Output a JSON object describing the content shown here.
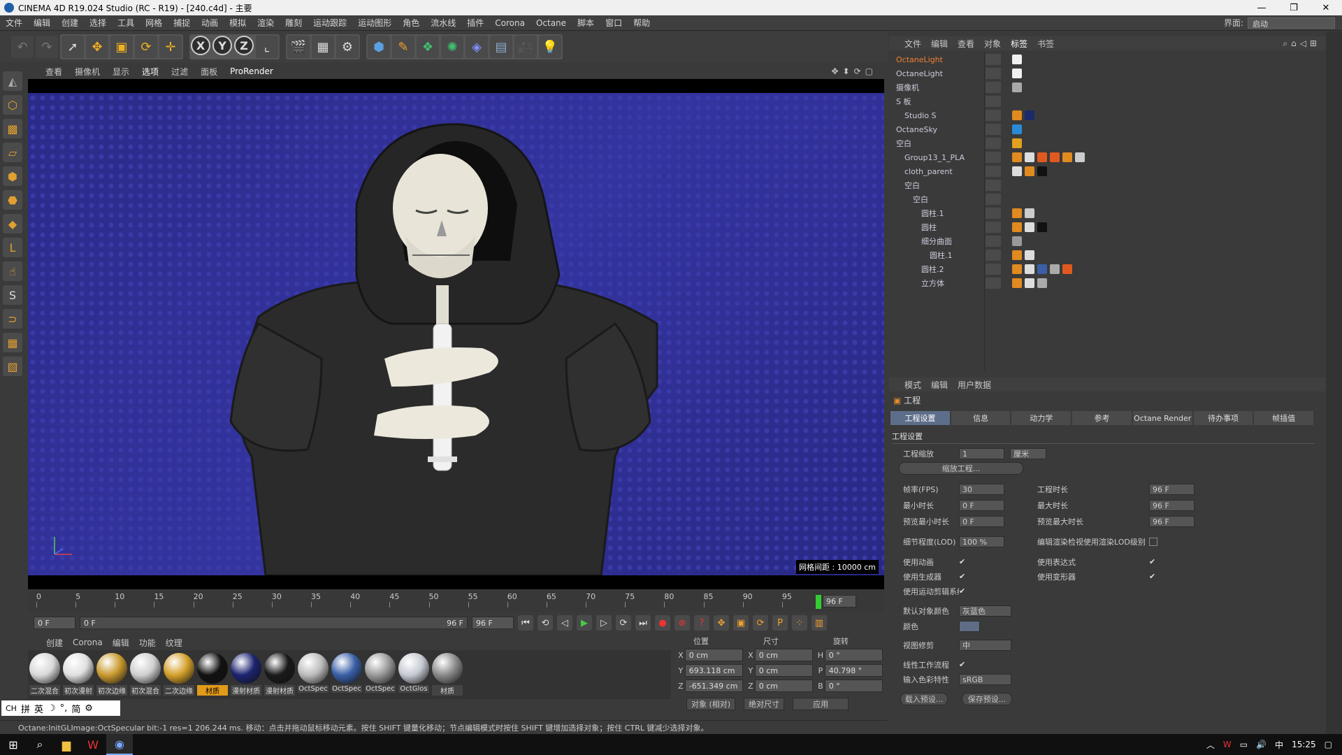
{
  "window": {
    "title": "CINEMA 4D R19.024 Studio (RC - R19) - [240.c4d] - 主要",
    "min": "—",
    "max": "❐",
    "close": "✕"
  },
  "menu": {
    "items": [
      "文件",
      "编辑",
      "创建",
      "选择",
      "工具",
      "网格",
      "捕捉",
      "动画",
      "模拟",
      "渲染",
      "雕刻",
      "运动跟踪",
      "运动图形",
      "角色",
      "流水线",
      "插件",
      "Corona",
      "Octane",
      "脚本",
      "窗口",
      "帮助"
    ],
    "layout_label": "界面:",
    "layout_value": "启动"
  },
  "viewport": {
    "menu": [
      "查看",
      "摄像机",
      "显示",
      "选项",
      "过滤",
      "面板"
    ],
    "prorender": "ProRender",
    "grid_info": "网格间距 : 10000 cm"
  },
  "timeline": {
    "ticks": [
      "0",
      "5",
      "10",
      "15",
      "20",
      "25",
      "30",
      "35",
      "40",
      "45",
      "50",
      "55",
      "60",
      "65",
      "70",
      "75",
      "80",
      "85",
      "90",
      "95"
    ],
    "current_frame": "96 F",
    "start": "0 F",
    "range_start": "0 F",
    "range_end": "96 F",
    "end": "96 F"
  },
  "material_manager": {
    "menu": [
      "创建",
      "Corona",
      "编辑",
      "功能",
      "纹理"
    ],
    "materials": [
      {
        "label": "二次混合",
        "color": "#d8d8d8"
      },
      {
        "label": "初次漫射",
        "color": "#e0e0e0"
      },
      {
        "label": "初次边缘",
        "color": "#c99a2e"
      },
      {
        "label": "初次混合",
        "color": "#cfcfcf"
      },
      {
        "label": "二次边缘",
        "color": "#d4a02a"
      },
      {
        "label": "材质",
        "color": "#111111",
        "selected": true
      },
      {
        "label": "漫射材质",
        "color": "#1c2470"
      },
      {
        "label": "漫射材质",
        "color": "#1a1a1a"
      },
      {
        "label": "OctSpec",
        "color": "#bcbcbc"
      },
      {
        "label": "OctSpec",
        "color": "#3a5fa8"
      },
      {
        "label": "OctSpec",
        "color": "#9a9a9a"
      },
      {
        "label": "OctGlos",
        "color": "#c5cad2"
      },
      {
        "label": "材质",
        "color": "#8a8a8a"
      }
    ]
  },
  "coordinates": {
    "headers": [
      "位置",
      "尺寸",
      "旋转"
    ],
    "rows": [
      {
        "pos_label": "X",
        "pos": "0 cm",
        "size_label": "X",
        "size": "0 cm",
        "rot_label": "H",
        "rot": "0 °"
      },
      {
        "pos_label": "Y",
        "pos": "693.118 cm",
        "size_label": "Y",
        "size": "0 cm",
        "rot_label": "P",
        "rot": "40.798 °"
      },
      {
        "pos_label": "Z",
        "pos": "-651.349 cm",
        "size_label": "Z",
        "size": "0 cm",
        "rot_label": "B",
        "rot": "0 °"
      }
    ],
    "mode": "对象 (相对)",
    "size_mode": "绝对尺寸",
    "apply": "应用"
  },
  "ime": {
    "items": [
      "CH",
      "拼",
      "英",
      "☽",
      "°,",
      "简",
      "⚙"
    ]
  },
  "status": "Octane:InitGLImage:OctSpecular  bit:-1 res=1 206.244 ms.     移动：点击并拖动鼠标移动元素。按住 SHIFT 键量化移动；节点编辑模式时按住 SHIFT 键增加选择对象；按住 CTRL 键减少选择对象。",
  "object_manager": {
    "menu": [
      "文件",
      "编辑",
      "查看",
      "对象",
      "标签",
      "书签"
    ],
    "active_menu": "标签",
    "objects": [
      {
        "name": "OctaneLight",
        "indent": 0,
        "hot": true,
        "tags": [
          "#f0f0f0"
        ]
      },
      {
        "name": "OctaneLight",
        "indent": 0,
        "hot": false,
        "tags": [
          "#f0f0f0"
        ]
      },
      {
        "name": "摄像机",
        "indent": 0,
        "hot": false,
        "tags": [
          "#aaaaaa"
        ]
      },
      {
        "name": "S 板",
        "indent": 0,
        "hot": false,
        "tags": []
      },
      {
        "name": "Studio S",
        "indent": 1,
        "hot": false,
        "tags": [
          "#e08a20",
          "#1a2a6a"
        ]
      },
      {
        "name": "OctaneSky",
        "indent": 0,
        "hot": false,
        "tags": [
          "#2a8ad8"
        ]
      },
      {
        "name": "空白",
        "indent": 0,
        "hot": false,
        "tags": [
          "#e0a020"
        ]
      },
      {
        "name": "Group13_1_PLA",
        "indent": 1,
        "hot": false,
        "tags": [
          "#e08a20",
          "#dddddd",
          "#e05a20",
          "#e05a20",
          "#e08a20",
          "#cccccc"
        ]
      },
      {
        "name": "cloth_parent",
        "indent": 1,
        "hot": false,
        "tags": [
          "#dddddd",
          "#e08a20",
          "#111111"
        ]
      },
      {
        "name": "空白",
        "indent": 1,
        "hot": false,
        "tags": []
      },
      {
        "name": "空白",
        "indent": 2,
        "hot": false,
        "tags": []
      },
      {
        "name": "圆柱.1",
        "indent": 3,
        "hot": false,
        "tags": [
          "#e08a20",
          "#cccccc"
        ]
      },
      {
        "name": "圆柱",
        "indent": 3,
        "hot": false,
        "tags": [
          "#e08a20",
          "#dddddd",
          "#111111"
        ]
      },
      {
        "name": "细分曲面",
        "indent": 3,
        "hot": false,
        "tags": [
          "#999999"
        ]
      },
      {
        "name": "圆柱.1",
        "indent": 4,
        "hot": false,
        "tags": [
          "#e08a20",
          "#dddddd"
        ]
      },
      {
        "name": "圆柱.2",
        "indent": 3,
        "hot": false,
        "tags": [
          "#e08a20",
          "#dddddd",
          "#3a5fa8",
          "#aaaaaa",
          "#e05a20"
        ]
      },
      {
        "name": "立方体",
        "indent": 3,
        "hot": false,
        "tags": [
          "#e08a20",
          "#dddddd",
          "#aaaaaa"
        ]
      }
    ]
  },
  "attribute_manager": {
    "menu": [
      "模式",
      "编辑",
      "用户数据"
    ],
    "title": "工程",
    "tabs": [
      "工程设置",
      "信息",
      "动力学",
      "参考",
      "Octane Render",
      "待办事项",
      "帧插值"
    ],
    "section": "工程设置",
    "scale_label": "工程缩放",
    "scale_value": "1",
    "scale_unit": "厘米",
    "scale_button": "缩放工程...",
    "fps_label": "帧率(FPS)",
    "fps": "30",
    "project_time_label": "工程时长",
    "project_time": "96 F",
    "min_time_label": "最小时长",
    "min_time": "0 F",
    "max_time_label": "最大时长",
    "max_time": "96 F",
    "prev_min_label": "预览最小时长",
    "prev_min": "0 F",
    "prev_max_label": "预览最大时长",
    "prev_max": "96 F",
    "lod_label": "细节程度(LOD)",
    "lod": "100 %",
    "lod_check_label": "编辑渲染检视使用渲染LOD级别",
    "use_anim": "使用动画",
    "use_expr": "使用表达式",
    "use_gen": "使用生成器",
    "use_deform": "使用变形器",
    "use_motion": "使用运动剪辑系统",
    "default_color_label": "默认对象颜色",
    "default_color": "灰蓝色",
    "color_label": "颜色",
    "view_clip_label": "视图修剪",
    "view_clip": "中",
    "linear_label": "线性工作流程",
    "input_color_label": "输入色彩特性",
    "input_color": "sRGB",
    "load_preset": "载入预设...",
    "save_preset": "保存预设..."
  },
  "taskbar": {
    "time": "15:25"
  }
}
